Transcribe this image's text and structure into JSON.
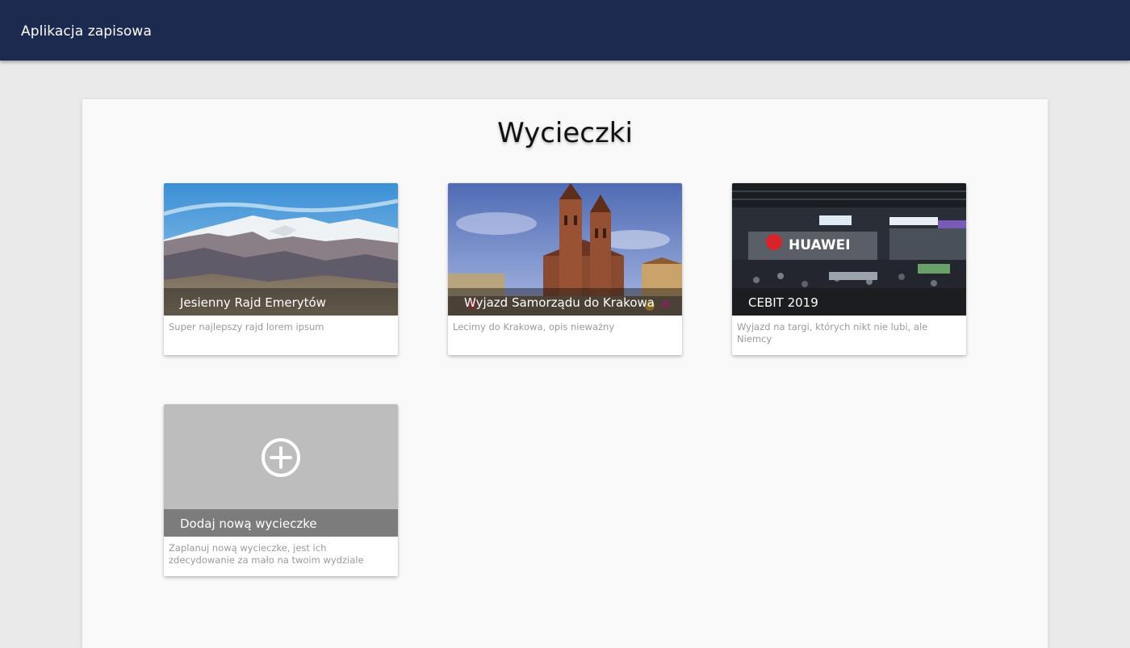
{
  "header": {
    "app_title": "Aplikacja zapisowa"
  },
  "main": {
    "title": "Wycieczki",
    "trips": [
      {
        "title": "Jesienny Rajd Emerytów",
        "description": "Super najlepszy rajd lorem ipsum"
      },
      {
        "title": "Wyjazd Samorządu do Krakowa",
        "description": "Lecimy do Krakowa, opis nieważny"
      },
      {
        "title": "CEBIT 2019",
        "description": "Wyjazd na targi, których nikt nie lubi, ale Niemcy",
        "image_text": "HUAWEI"
      }
    ],
    "add_card": {
      "title": "Dodaj nową wycieczke",
      "description": "Zaplanuj nową wycieczke, jest ich zdecydowanie za mało na twoim wydziale",
      "icon": "plus-circle-icon"
    }
  },
  "colors": {
    "header_bg": "#1c2a4f",
    "page_bg": "#eaeaea",
    "panel_bg": "#f9f9f9"
  }
}
